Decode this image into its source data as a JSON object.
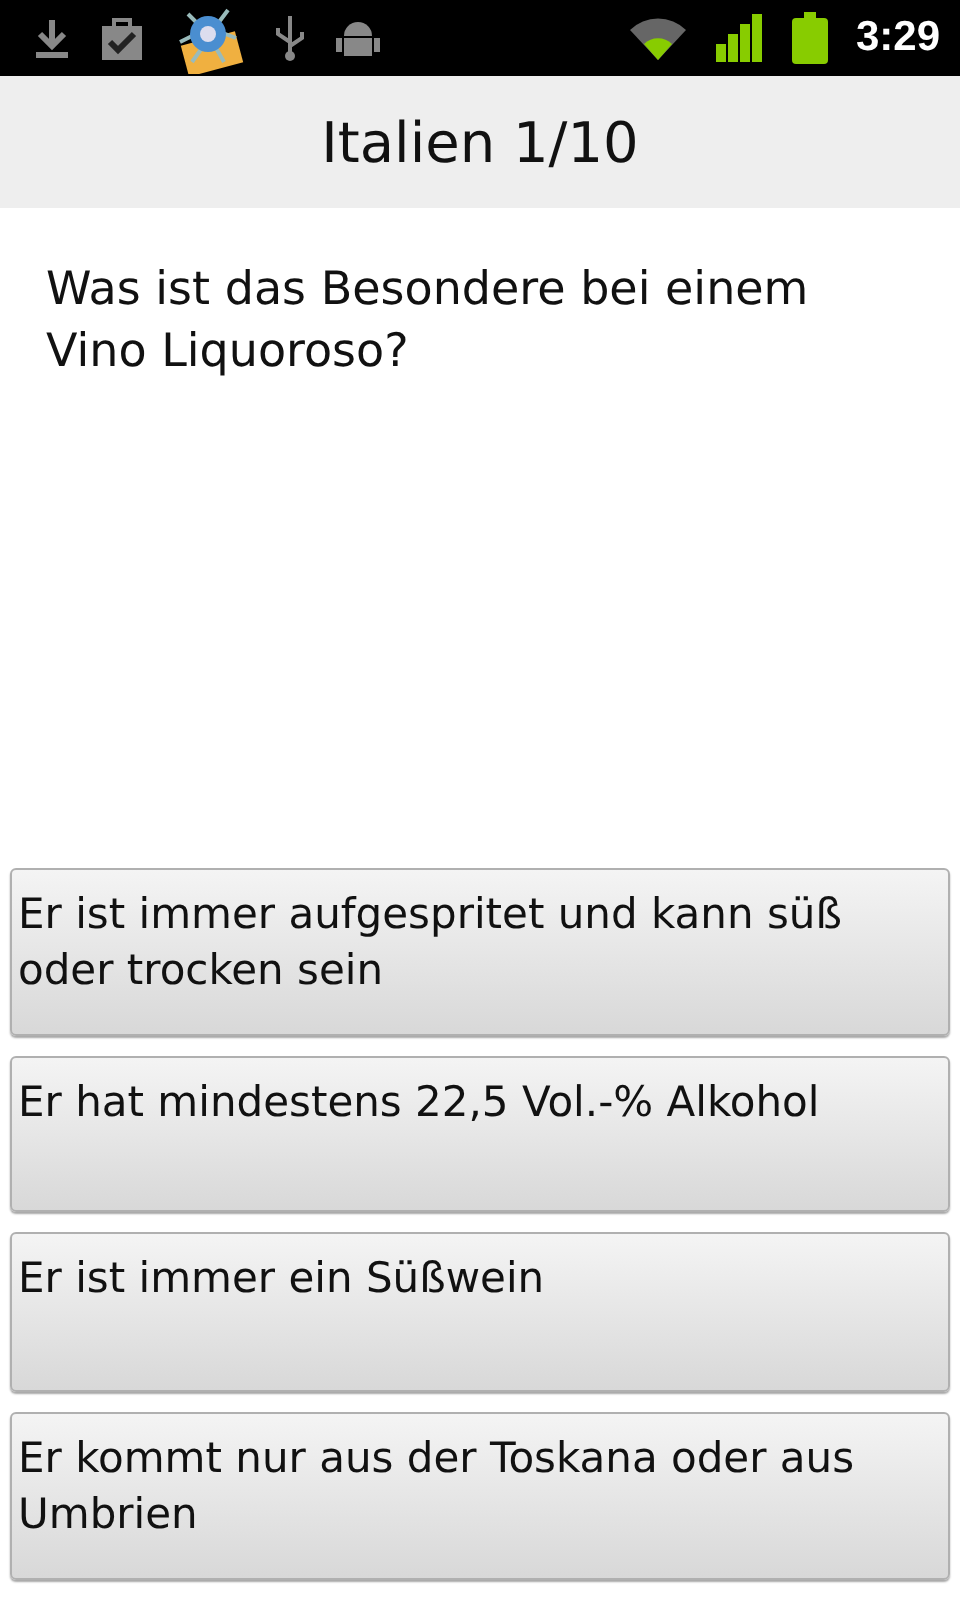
{
  "status_bar": {
    "time": "3:29"
  },
  "title": "Italien 1/10",
  "question": "Was ist das Besondere bei einem Vino Liquoroso?",
  "answers": [
    {
      "label": "Er ist immer aufgespritet und kann süß oder trocken sein"
    },
    {
      "label": "Er hat mindestens 22,5 Vol.-% Alkohol"
    },
    {
      "label": "Er ist immer ein Süßwein"
    },
    {
      "label": "Er kommt nur aus der Toskana oder aus Umbrien"
    }
  ]
}
